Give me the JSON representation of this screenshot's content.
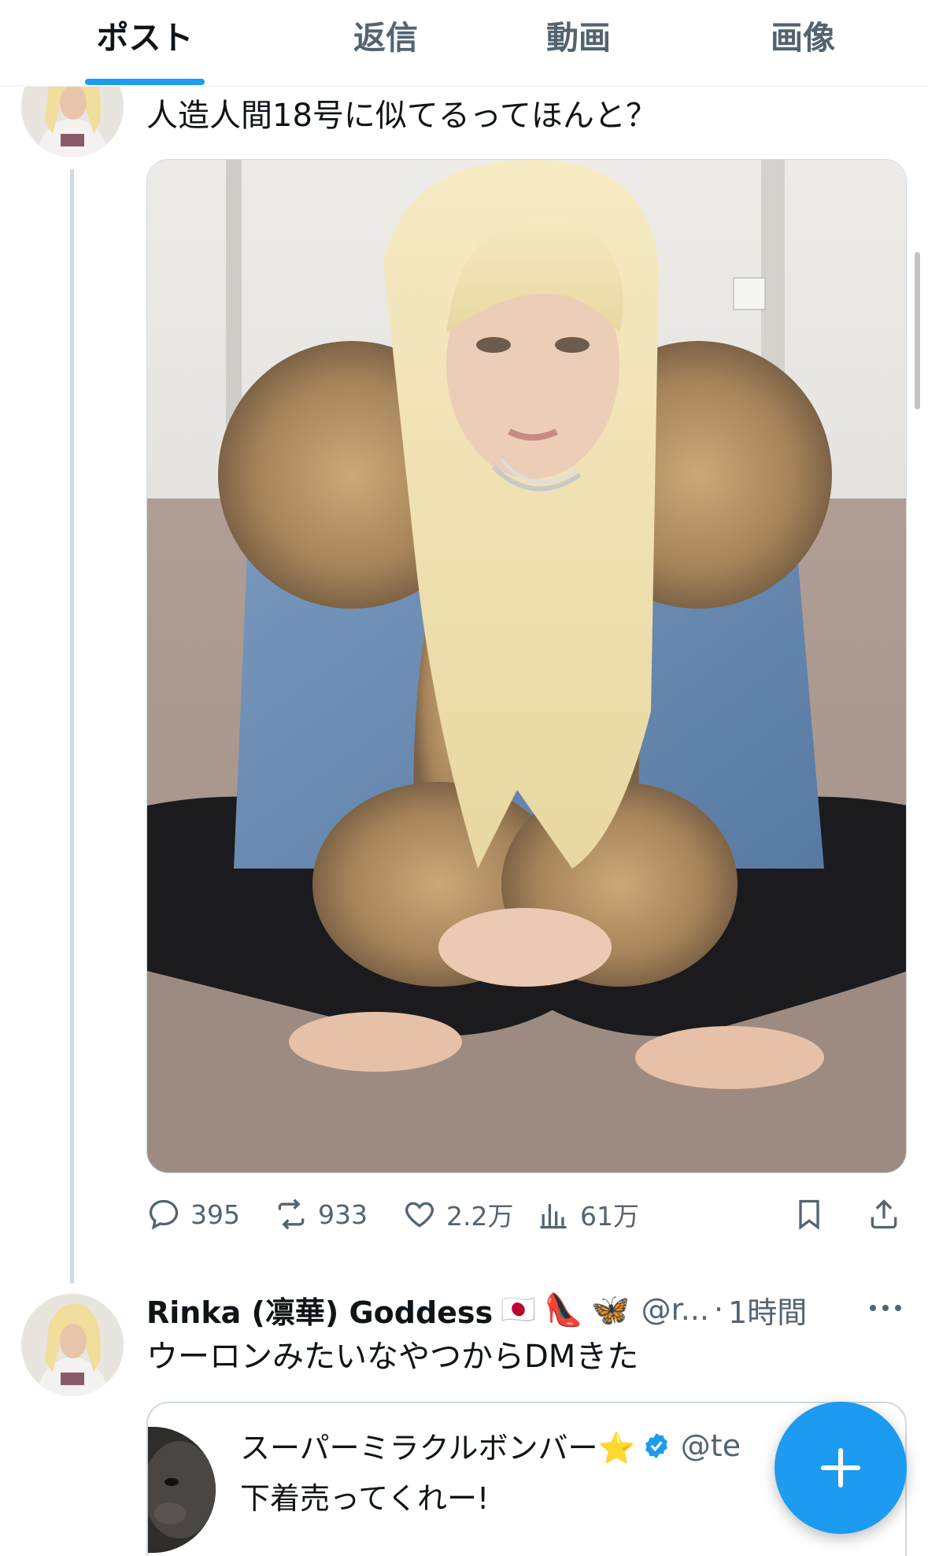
{
  "tabs": [
    {
      "label": "ポスト",
      "active": true
    },
    {
      "label": "返信",
      "active": false
    },
    {
      "label": "動画",
      "active": false
    },
    {
      "label": "画像",
      "active": false
    }
  ],
  "post1": {
    "text": "人造人間18号に似てるってほんと？",
    "actions": {
      "replies": "395",
      "reposts": "933",
      "likes": "2.2万",
      "views": "61万"
    }
  },
  "post2": {
    "name": "Rinka (凛華) Goddess",
    "name_emojis": [
      "🇯🇵",
      "👠",
      "🦋"
    ],
    "handle": "@r...",
    "separator": "·",
    "time": "1時間",
    "text": "ウーロンみたいなやつからDMきた",
    "quote": {
      "name": "スーパーミラクルボンバー⭐",
      "handle": "@te",
      "text": "下着売ってくれー!"
    }
  },
  "colors": {
    "accent": "#1d9bf0",
    "secondary_text": "#536471",
    "border": "#cfd9de"
  },
  "icons": [
    "reply-icon",
    "repost-icon",
    "like-icon",
    "views-icon",
    "bookmark-icon",
    "share-icon",
    "more-icon",
    "verified-icon",
    "compose-icon"
  ]
}
